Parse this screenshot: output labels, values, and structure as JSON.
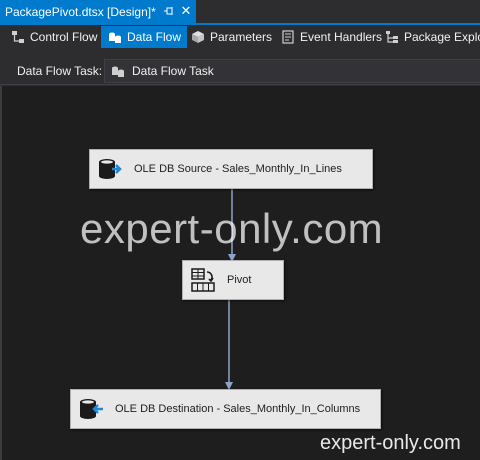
{
  "document_tab": {
    "title": "PackagePivot.dtsx [Design]*"
  },
  "designer_tabs": [
    {
      "label": "Control Flow",
      "icon": "control-flow-icon",
      "active": false
    },
    {
      "label": "Data Flow",
      "icon": "data-flow-icon",
      "active": true
    },
    {
      "label": "Parameters",
      "icon": "parameters-icon",
      "active": false
    },
    {
      "label": "Event Handlers",
      "icon": "event-handlers-icon",
      "active": false
    },
    {
      "label": "Package Explor",
      "icon": "package-explorer-icon",
      "active": false
    }
  ],
  "task_bar": {
    "label": "Data Flow Task:",
    "selected": "Data Flow Task"
  },
  "components": {
    "source": {
      "label": "OLE DB Source - Sales_Monthly_In_Lines",
      "icon": "ole-db-source-icon"
    },
    "pivot": {
      "label": "Pivot",
      "icon": "pivot-icon"
    },
    "destination": {
      "label": "OLE DB Destination - Sales_Monthly_In_Columns",
      "icon": "ole-db-destination-icon"
    }
  },
  "watermark": {
    "center": "expert-only.com",
    "corner": "expert-only.com"
  },
  "colors": {
    "accent": "#007acc",
    "canvas": "#1e1e1e",
    "chrome": "#2d2d30",
    "connector": "#8ca4c8",
    "component": "#e8e8e8"
  }
}
